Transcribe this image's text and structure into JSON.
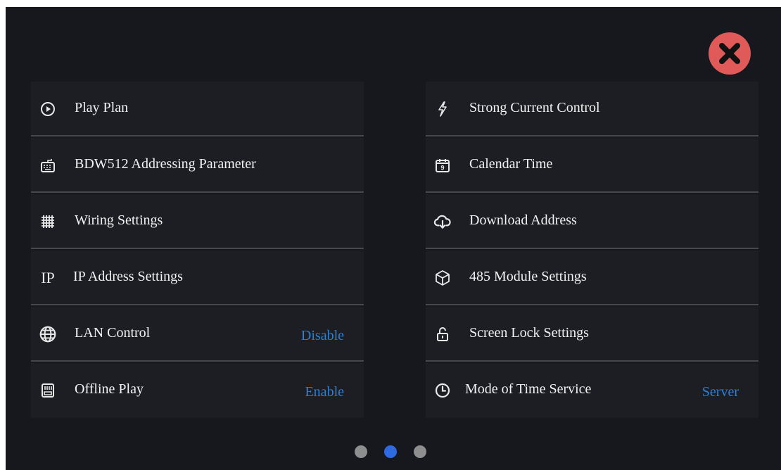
{
  "left_items": [
    {
      "label": "Play Plan",
      "value": "",
      "icon": "play-circle-icon"
    },
    {
      "label": "BDW512 Addressing Parameter",
      "value": "",
      "icon": "keyboard-icon"
    },
    {
      "label": "Wiring Settings",
      "value": "",
      "icon": "grid-icon"
    },
    {
      "label": "IP Address Settings",
      "value": "",
      "icon": "ip-icon",
      "icon_text": "IP"
    },
    {
      "label": "LAN Control",
      "value": "Disable",
      "icon": "globe-icon"
    },
    {
      "label": "Offline Play",
      "value": "Enable",
      "icon": "sd-card-icon"
    }
  ],
  "right_items": [
    {
      "label": "Strong Current Control",
      "value": "",
      "icon": "lightning-icon"
    },
    {
      "label": "Calendar Time",
      "value": "",
      "icon": "calendar-icon",
      "icon_text": "9"
    },
    {
      "label": "Download Address",
      "value": "",
      "icon": "cloud-download-icon"
    },
    {
      "label": "485 Module Settings",
      "value": "",
      "icon": "cube-icon"
    },
    {
      "label": "Screen Lock Settings",
      "value": "",
      "icon": "unlock-icon"
    },
    {
      "label": "Mode of Time Service",
      "value": "Server",
      "icon": "clock-icon"
    }
  ],
  "pager": {
    "count": 3,
    "active_index": 1
  },
  "colors": {
    "background": "#17181e",
    "row": "#1d1e24",
    "divider": "#47484e",
    "accent": "#2f7fd1",
    "close": "#e05a5a",
    "active_dot": "#2f6ae0",
    "inactive_dot": "#8e8e8e"
  }
}
